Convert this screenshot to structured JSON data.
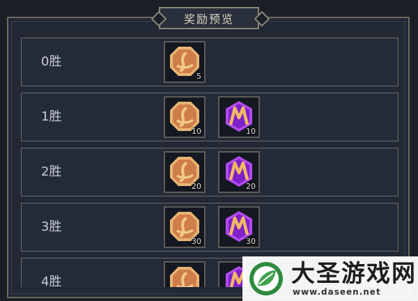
{
  "window": {
    "title": "奖励预览"
  },
  "rows": [
    {
      "label": "0胜",
      "rewards": [
        {
          "icon": "coin-icon",
          "qty": "5"
        }
      ]
    },
    {
      "label": "1胜",
      "rewards": [
        {
          "icon": "coin-icon",
          "qty": "10"
        },
        {
          "icon": "purple-gem-icon",
          "qty": "10"
        }
      ]
    },
    {
      "label": "2胜",
      "rewards": [
        {
          "icon": "coin-icon",
          "qty": "20"
        },
        {
          "icon": "purple-gem-icon",
          "qty": "20"
        }
      ]
    },
    {
      "label": "3胜",
      "rewards": [
        {
          "icon": "coin-icon",
          "qty": "30"
        },
        {
          "icon": "purple-gem-icon",
          "qty": "30"
        }
      ]
    },
    {
      "label": "4胜",
      "rewards": [
        {
          "icon": "coin-icon",
          "qty": ""
        },
        {
          "icon": "purple-gem-icon",
          "qty": ""
        }
      ]
    }
  ],
  "watermark": {
    "name": "大圣游戏网",
    "url": "www.daseen.net"
  },
  "colors": {
    "coin": "#d78a4e",
    "gem": "#8a2bd4",
    "panel_border": "#6d6a5f"
  }
}
